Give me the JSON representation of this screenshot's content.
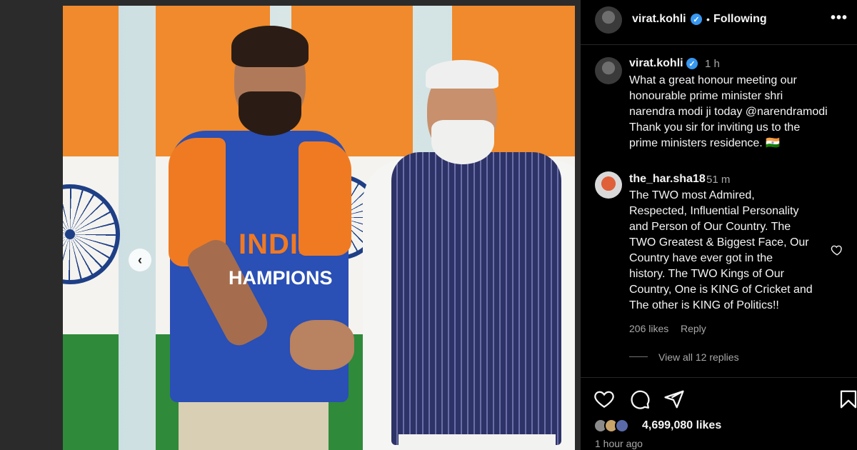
{
  "post": {
    "photo_alt": "",
    "jersey_line1": "INDIA",
    "jersey_line2": "HAMPIONS",
    "carousel_prev": "‹"
  },
  "header": {
    "username": "virat.kohli",
    "verified_mark": "✓",
    "separator": "•",
    "follow_status": "Following",
    "more_icon": "more-options-icon"
  },
  "caption": {
    "username": "virat.kohli",
    "time": "1 h",
    "text": "What a great honour meeting our\nhonourable prime minister shri\nnarendra modi ji today @narendramodi\nThank you sir for inviting us to the\nprime ministers residence. 🇮🇳"
  },
  "comment": {
    "username": "the_har.sha18",
    "time": "51 m",
    "text": "The TWO most Admired,\nRespected, Influential Personality\nand Person of Our Country. The\nTWO Greatest & Biggest Face, Our\nCountry have ever got in the\nhistory. The TWO Kings of Our\nCountry, One is KING of Cricket and\nThe other is KING of Politics!!",
    "likes": "206 likes",
    "reply_label": "Reply",
    "view_replies": "View all 12 replies"
  },
  "actions": {
    "like_icon": "heart-icon",
    "comment_icon": "comment-icon",
    "share_icon": "share-icon",
    "save_icon": "bookmark-icon"
  },
  "stats": {
    "likes": "4,699,080 likes",
    "posted_ago": "1 hour ago"
  },
  "colors": {
    "panel_bg": "#000000",
    "text": "#f5f5f5",
    "muted": "#a8a8a8",
    "verified": "#3897f0"
  }
}
